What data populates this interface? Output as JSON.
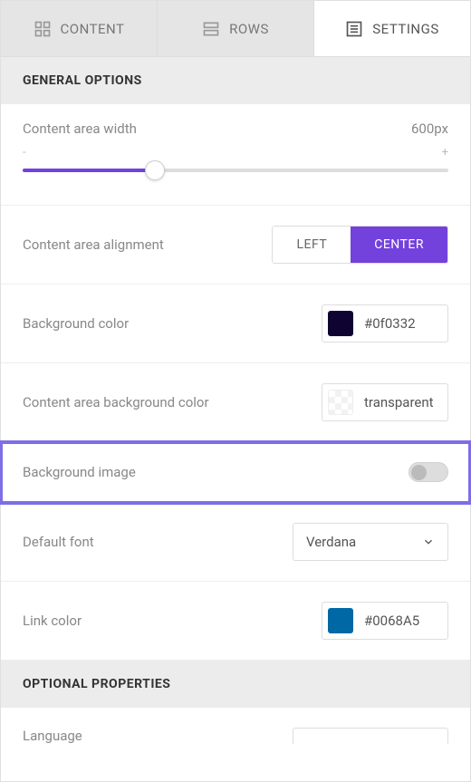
{
  "tabs": {
    "content": "CONTENT",
    "rows": "ROWS",
    "settings": "SETTINGS"
  },
  "sections": {
    "general": "GENERAL OPTIONS",
    "optional": "OPTIONAL PROPERTIES"
  },
  "options": {
    "contentAreaWidth": {
      "label": "Content area width",
      "value": "600px",
      "minus": "-",
      "plus": "+"
    },
    "alignment": {
      "label": "Content area alignment",
      "left": "LEFT",
      "center": "CENTER"
    },
    "bgColor": {
      "label": "Background color",
      "value": "#0f0332",
      "swatch": "#0f0332"
    },
    "contentBgColor": {
      "label": "Content area background color",
      "value": "transparent"
    },
    "bgImage": {
      "label": "Background image"
    },
    "defaultFont": {
      "label": "Default font",
      "value": "Verdana"
    },
    "linkColor": {
      "label": "Link color",
      "value": "#0068A5",
      "swatch": "#0068A5"
    },
    "language": {
      "label": "Language",
      "value": "—"
    }
  }
}
